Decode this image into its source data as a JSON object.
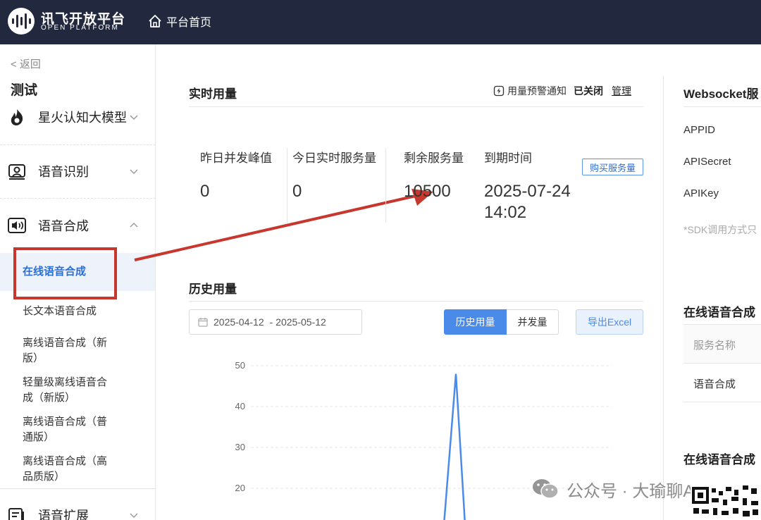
{
  "header": {
    "logo_cn": "讯飞开放平台",
    "logo_en": "OPEN PLATFORM",
    "home_label": "平台首页"
  },
  "sidebar": {
    "back_label": "< 返回",
    "title": "测试",
    "groups": [
      {
        "label": "星火认知大模型",
        "icon": "spark-flame-icon",
        "expanded": false
      },
      {
        "label": "语音识别",
        "icon": "speech-recognition-icon",
        "expanded": false
      },
      {
        "label": "语音合成",
        "icon": "speaker-icon",
        "expanded": true
      },
      {
        "label": "语音扩展",
        "icon": "speech-extension-icon",
        "expanded": false
      }
    ],
    "sub_items": [
      {
        "label": "在线语音合成",
        "active": true
      },
      {
        "label": "长文本语音合成",
        "active": false
      },
      {
        "label": "离线语音合成（新版）",
        "active": false
      },
      {
        "label": "轻量级离线语音合成（新版）",
        "active": false
      },
      {
        "label": "离线语音合成（普通版）",
        "active": false
      },
      {
        "label": "离线语音合成（高品质版）",
        "active": false
      }
    ]
  },
  "realtime": {
    "title": "实时用量",
    "alert_label": "用量预警通知",
    "alert_status": "已关闭",
    "manage_label": "管理",
    "stats": [
      {
        "label": "昨日并发峰值",
        "value": "0"
      },
      {
        "label": "今日实时服务量",
        "value": "0"
      },
      {
        "label": "剩余服务量",
        "value": "10500"
      },
      {
        "label": "到期时间",
        "value": "2025-07-24",
        "value2": "14:02"
      }
    ],
    "buy_label": "购买服务量"
  },
  "history": {
    "title": "历史用量",
    "date_start": "2025-04-12",
    "date_end": "- 2025-05-12",
    "tab_active": "历史用量",
    "tab_other": "并发量",
    "export_label": "导出Excel"
  },
  "chart_data": {
    "type": "line",
    "y_ticks": [
      50,
      40,
      30,
      20
    ],
    "ylim": [
      0,
      50
    ],
    "series": [
      {
        "values_visible_peak": 48
      }
    ],
    "color": "#4a8bea"
  },
  "right_panel": {
    "ws_title": "Websocket服",
    "keys": [
      "APPID",
      "APISecret",
      "APIKey"
    ],
    "note": "*SDK调用方式只",
    "table1_title": "在线语音合成",
    "table1_header": "服务名称",
    "table1_row": "语音合成",
    "table2_title": "在线语音合成"
  },
  "watermark": {
    "text": "公众号 · 大瑜聊AI"
  },
  "colors": {
    "topbar": "#22283d",
    "accent": "#4a8bea",
    "annotation": "#c8372d"
  }
}
